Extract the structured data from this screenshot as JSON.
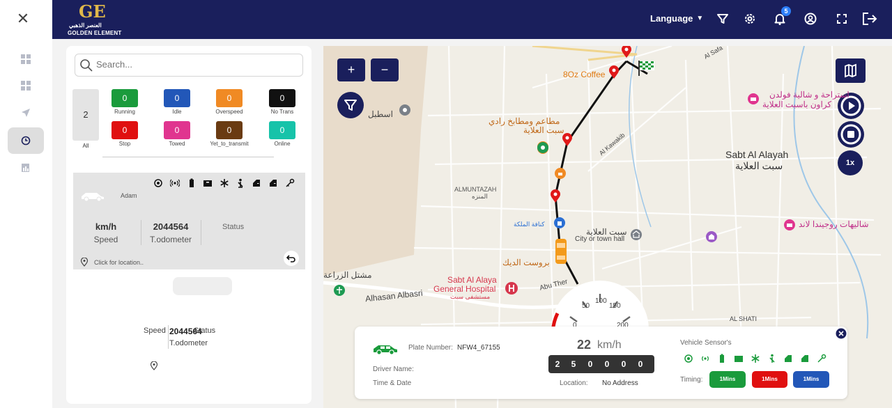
{
  "header": {
    "brand_arabic": "العنصر الذهبي",
    "brand_name": "GOLDEN ELEMENT",
    "language_label": "Language",
    "notification_count": "5"
  },
  "search": {
    "placeholder": "Search..."
  },
  "summary": {
    "all_count": "2",
    "all_label": "All",
    "statuses": [
      {
        "count": "0",
        "label": "Running",
        "color": "#1a9b3c"
      },
      {
        "count": "0",
        "label": "Idle",
        "color": "#2257b8"
      },
      {
        "count": "0",
        "label": "Overspeed",
        "color": "#f08a24"
      },
      {
        "count": "0",
        "label": "No Trans",
        "color": "#111111"
      },
      {
        "count": "0",
        "label": "Stop",
        "color": "#e01010"
      },
      {
        "count": "0",
        "label": "Towed",
        "color": "#e0358f"
      },
      {
        "count": "0",
        "label": "Yet_to_transmit",
        "color": "#6a3b12"
      },
      {
        "count": "0",
        "label": "Online",
        "color": "#17c3a9"
      }
    ]
  },
  "vehicle_card": {
    "driver": "Adam",
    "speed_value": "km/h",
    "speed_label": "Speed",
    "odometer_value": "2044564",
    "odometer_label": "T.odometer",
    "status_label": "Status",
    "location_text": "Click for location.."
  },
  "vehicle_card2": {
    "speed_label": "Speed",
    "odometer_value": "2044564",
    "status_label": "Status",
    "odometer_label": "T.odometer"
  },
  "map": {
    "zoom_in": "+",
    "zoom_out": "−",
    "playback_speed": "1x",
    "labels": [
      {
        "text": "Sabt Al Alayah",
        "name": "map-label-sabt-al-alayah"
      },
      {
        "text": "سبت العلاية",
        "name": "map-label-sabt-al-alayah-ar"
      },
      {
        "text": "ALMUNTAZAH",
        "name": "map-label-almuntazah"
      },
      {
        "text": "المنزه",
        "name": "map-label-almuntazah-ar"
      },
      {
        "text": "8Oz Coffee",
        "name": "map-label-8oz-coffee"
      },
      {
        "text": "مطاعم ومطابخ رادي",
        "name": "map-label-restaurant-ar"
      },
      {
        "text": "سبت العلاية",
        "name": "map-label-restaurant-ar-2"
      },
      {
        "text": "اسطبل",
        "name": "map-label-stable-ar"
      },
      {
        "text": "Al Kawakib",
        "name": "map-label-al-kawakib"
      },
      {
        "text": "كنافة الملكة",
        "name": "map-label-kunafa-ar"
      },
      {
        "text": "سبت العلاية",
        "name": "map-label-town-hall-ar"
      },
      {
        "text": "City or town hall",
        "name": "map-label-town-hall"
      },
      {
        "text": "بروست الديك",
        "name": "map-label-broast-ar"
      },
      {
        "text": "Sabt Al Alaya",
        "name": "map-label-hospital-1"
      },
      {
        "text": "General Hospital",
        "name": "map-label-hospital-2"
      },
      {
        "text": "مستشفى سبت",
        "name": "map-label-hospital-ar"
      },
      {
        "text": "Alhasan Albasri",
        "name": "map-label-alhasan-albasri"
      },
      {
        "text": "Abu Ther",
        "name": "map-label-abu-ther"
      },
      {
        "text": "مشتل الزراعة",
        "name": "map-label-nursery-ar"
      },
      {
        "text": "شاليهات روجيندا لاند",
        "name": "map-label-chalets-ar"
      },
      {
        "text": "استراحة و شالية فولدن",
        "name": "map-label-resort-ar"
      },
      {
        "text": "كراون باسبت العلاية",
        "name": "map-label-resort-ar-2"
      },
      {
        "text": "AL SHATI",
        "name": "map-label-al-shati"
      },
      {
        "text": "Al Safa",
        "name": "map-label-al-safa"
      }
    ]
  },
  "gauge": {
    "ticks": [
      "0",
      "50",
      "100",
      "150",
      "200"
    ]
  },
  "info": {
    "plate_label": "Plate Number:",
    "plate_value": "NFW4_67155",
    "driver_label": "Driver Name:",
    "time_label": "Time & Date",
    "speed_value": "22",
    "speed_unit": "km/h",
    "odometer_digits": [
      "2",
      "5",
      "0",
      "0",
      "0",
      "0"
    ],
    "location_label": "Location:",
    "location_value": "No Address",
    "sensor_label": "Vehicle Sensor's",
    "timing_label": "Timing:",
    "timing": [
      {
        "label": "1Mins",
        "color": "#1a9b3c"
      },
      {
        "label": "1Mins",
        "color": "#e01010"
      },
      {
        "label": "1Mins",
        "color": "#2257b8"
      }
    ]
  }
}
